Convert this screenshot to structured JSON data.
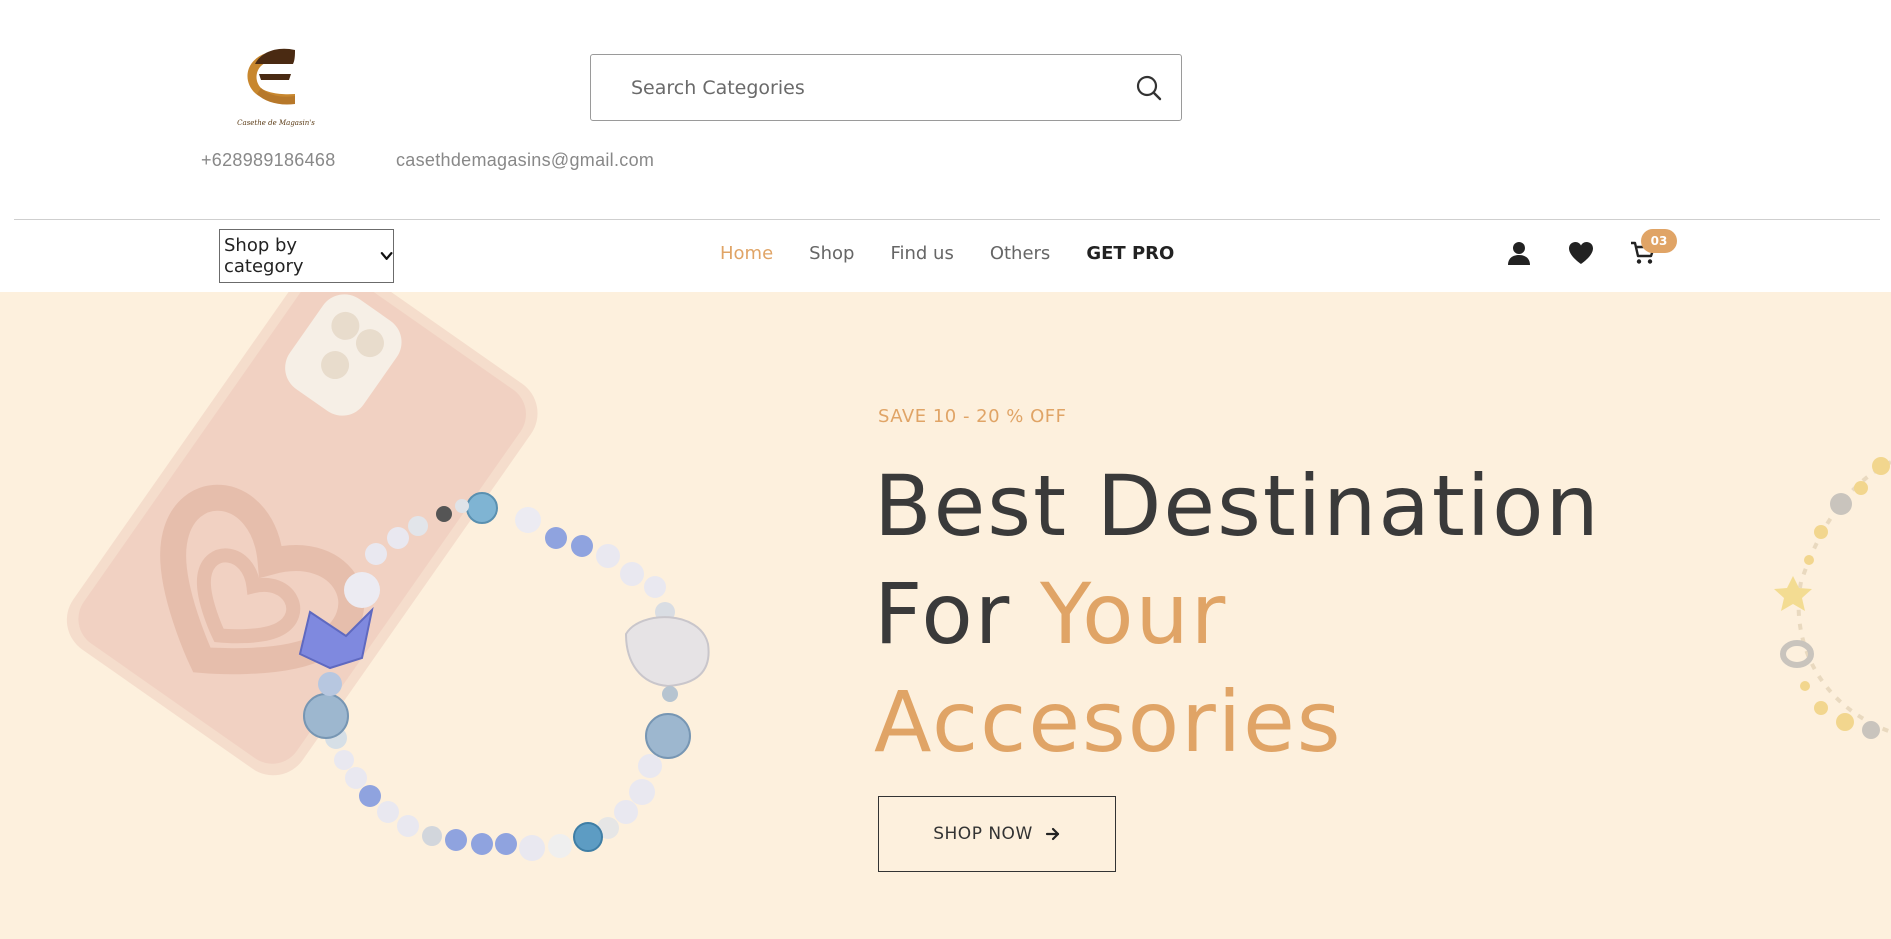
{
  "brand": {
    "tagline": "Casethe de Magasin's",
    "logo_colors": [
      "#4a2a12",
      "#c8872e"
    ]
  },
  "search": {
    "placeholder": "Search Categories",
    "icon": "search-icon"
  },
  "contact": {
    "phone": "+628989186468",
    "email": "casethdemagasins@gmail.com"
  },
  "nav": {
    "category_label": "Shop by category",
    "items": [
      {
        "label": "Home",
        "active": true
      },
      {
        "label": "Shop"
      },
      {
        "label": "Find us"
      },
      {
        "label": "Others"
      },
      {
        "label": "GET PRO"
      }
    ],
    "cart_count": "03",
    "icons": [
      "user-icon",
      "heart-icon",
      "cart-icon"
    ]
  },
  "hero": {
    "promo": "SAVE 10 - 20 % OFF",
    "headline_line1": "Best Destination",
    "headline_line2_prefix": "For ",
    "headline_line2_accent": "Your",
    "headline_line3_accent": "Accesories",
    "cta_label": "SHOP NOW",
    "background": "#fdf0dd",
    "accent": "#e0a466"
  }
}
